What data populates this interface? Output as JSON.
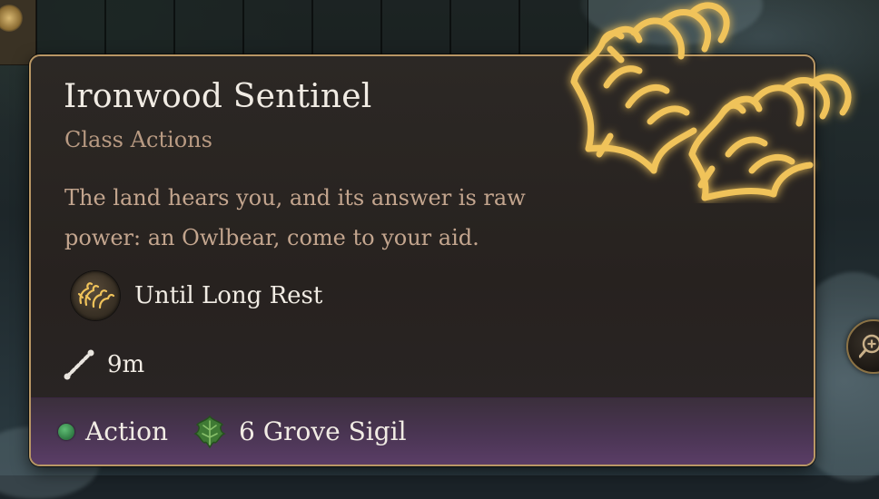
{
  "tooltip": {
    "title": "Ironwood Sentinel",
    "subtitle": "Class Actions",
    "description": "The land hears you, and its answer is raw power: an Owlbear, come to your aid.",
    "duration": "Until Long Rest",
    "range": "9m",
    "costs": {
      "action_label": "Action",
      "resource_label": "6 Grove Sigil"
    }
  },
  "colors": {
    "border": "#b99765",
    "title": "#f1ece4",
    "subtitle": "#b89a82",
    "description": "#c3a58e",
    "glyph_gold": "#f0c35a",
    "action_green": "#3f9a55",
    "cost_bar_purple": "#5a3d66"
  },
  "icons": {
    "art": "claw-marks-icon",
    "duration": "claw-marks-icon",
    "range": "range-dotted-line-icon",
    "action": "action-dot-icon",
    "resource": "grove-leaf-icon",
    "zoom": "magnify-plus-icon"
  }
}
